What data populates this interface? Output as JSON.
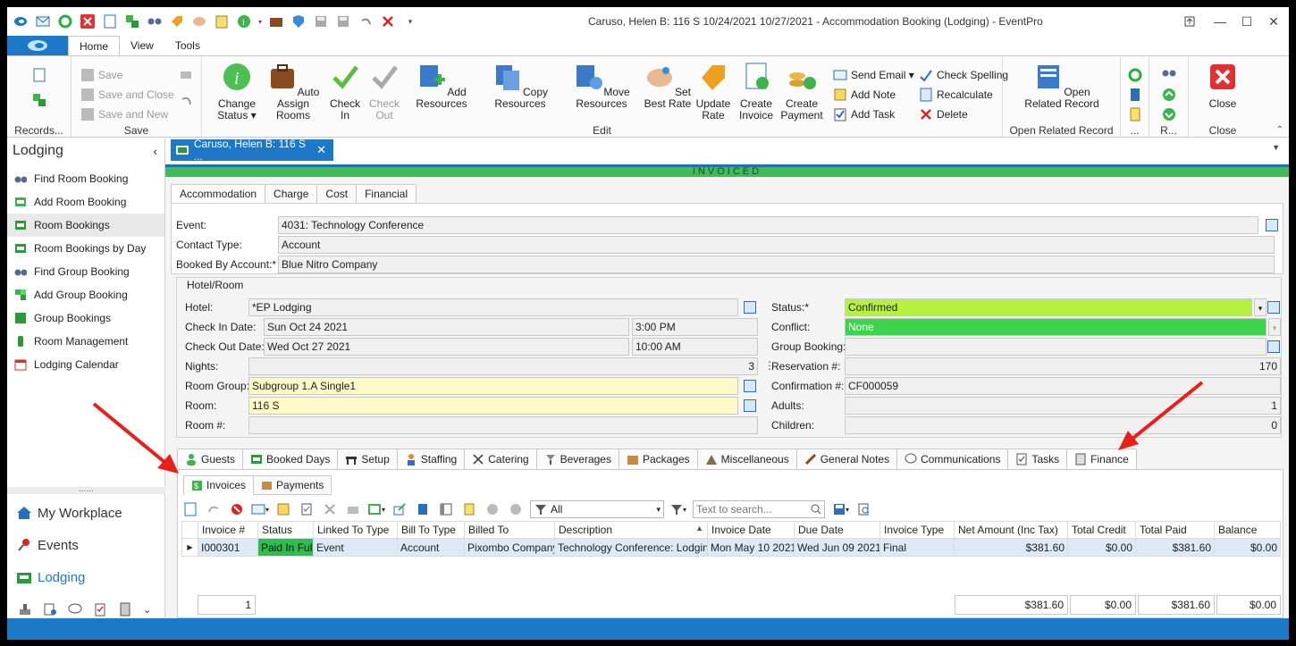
{
  "window": {
    "title": "Caruso, Helen B: 116 S 10/24/2021 10/27/2021  - Accommodation Booking (Lodging) - EventPro"
  },
  "ribbon_tabs": [
    "Home",
    "View",
    "Tools"
  ],
  "ribbon": {
    "records_label": "Records...",
    "save_group": {
      "label": "Save",
      "save": "Save",
      "save_close": "Save and Close",
      "save_new": "Save and New"
    },
    "edit_group": {
      "label": "Edit",
      "change_status": "Change Status",
      "auto_assign": "Auto Assign Rooms",
      "check_in": "Check In",
      "check_out": "Check Out",
      "add_resources": "Add Resources",
      "copy_resources": "Copy Resources",
      "move_resources": "Move Resources",
      "set_best_rate": "Set Best Rate",
      "update_rate": "Update Rate",
      "create_invoice": "Create Invoice",
      "create_payment": "Create Payment",
      "send_email": "Send Email",
      "add_note": "Add Note",
      "add_task": "Add Task",
      "check_spelling": "Check Spelling",
      "recalculate": "Recalculate",
      "delete": "Delete"
    },
    "open_related": {
      "label": "Open Related Record",
      "button": "Open Related Record"
    },
    "dots_label": "...",
    "r_label": "R...",
    "close_group": {
      "label": "Close",
      "button": "Close"
    }
  },
  "left_panel": {
    "title": "Lodging",
    "items": [
      {
        "label": "Find Room Booking",
        "icon": "binoculars-icon"
      },
      {
        "label": "Add Room Booking",
        "icon": "add-booking-icon"
      },
      {
        "label": "Room Bookings",
        "icon": "bookings-icon"
      },
      {
        "label": "Room Bookings by Day",
        "icon": "bookings-day-icon"
      },
      {
        "label": "Find Group Booking",
        "icon": "binoculars-icon"
      },
      {
        "label": "Add Group Booking",
        "icon": "add-group-icon"
      },
      {
        "label": "Group Bookings",
        "icon": "group-icon"
      },
      {
        "label": "Room Management",
        "icon": "room-mgmt-icon"
      },
      {
        "label": "Lodging Calendar",
        "icon": "calendar-icon"
      }
    ],
    "nav": [
      "My Workplace",
      "Events",
      "Lodging"
    ]
  },
  "doc_tab": "Caruso, Helen B: 116 S ...",
  "status_banner": "INVOICED",
  "top_tabs": [
    "Accommodation",
    "Charge",
    "Cost",
    "Financial"
  ],
  "form": {
    "event_label": "Event:",
    "event_value": "4031: Technology Conference",
    "contact_type_label": "Contact Type:",
    "contact_type_value": "Account",
    "booked_by_label": "Booked By Account:*",
    "booked_by_value": "Blue Nitro Company",
    "hotel_room_title": "Hotel/Room",
    "hotel_label": "Hotel:",
    "hotel_value": "*EP Lodging",
    "checkin_label": "Check In Date:",
    "checkin_date": "Sun Oct 24 2021",
    "checkin_time": "3:00 PM",
    "checkout_label": "Check Out Date:",
    "checkout_date": "Wed Oct 27 2021",
    "checkout_time": "10:00 AM",
    "nights_label": "Nights:",
    "nights_value": "3",
    "room_group_label": "Room Group:",
    "room_group_value": "Subgroup 1.A Single1",
    "room_label": "Room:",
    "room_value": "116 S",
    "room_no_label": "Room #:",
    "room_no_value": "",
    "status_label": "Status:*",
    "status_value": "Confirmed",
    "conflict_label": "Conflict:",
    "conflict_value": "None",
    "group_booking_label": "Group Booking:",
    "group_booking_value": "",
    "reservation_label": "Reservation #:",
    "reservation_value": "170",
    "confirmation_label": "Confirmation #:",
    "confirmation_value": "CF000059",
    "adults_label": "Adults:",
    "adults_value": "1",
    "children_label": "Children:",
    "children_value": "0"
  },
  "bottom_tabs": [
    "Guests",
    "Booked Days",
    "Setup",
    "Staffing",
    "Catering",
    "Beverages",
    "Packages",
    "Miscellaneous",
    "General Notes",
    "Communications",
    "Tasks",
    "Finance"
  ],
  "finance_tabs": [
    "Invoices",
    "Payments"
  ],
  "toolbar": {
    "filter_value": "All",
    "search_placeholder": "Text to search..."
  },
  "grid": {
    "columns": [
      "Invoice #",
      "Status",
      "Linked To Type",
      "Bill To Type",
      "Billed To",
      "Description",
      "Invoice Date",
      "Due Date",
      "Invoice Type",
      "Net Amount (Inc Tax)",
      "Total Credit",
      "Total Paid",
      "Balance"
    ],
    "rows": [
      [
        "I000301",
        "Paid In Full",
        "Event",
        "Account",
        "Pixombo Company",
        "Technology Conference: Lodging",
        "Mon May 10 2021",
        "Wed Jun 09 2021",
        "Final",
        "$381.60",
        "$0.00",
        "$381.60",
        "$0.00"
      ]
    ],
    "footer": {
      "count": "1",
      "net": "$381.60",
      "credit": "$0.00",
      "paid": "$381.60",
      "balance": "$0.00"
    }
  }
}
